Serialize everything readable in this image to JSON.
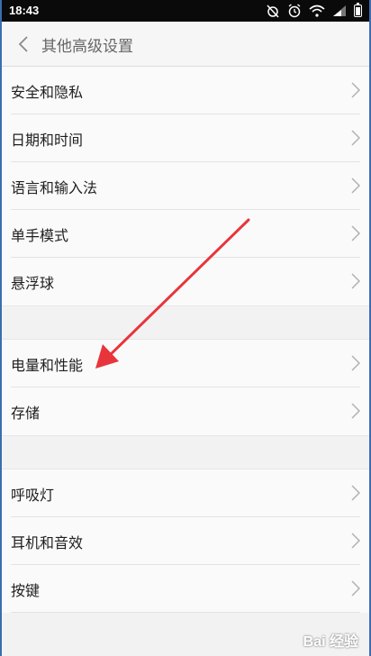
{
  "status_bar": {
    "time": "18:43",
    "icons": [
      "alarm-off-icon",
      "alarm-icon",
      "wifi-icon",
      "signal-icon",
      "battery-icon"
    ]
  },
  "header": {
    "title": "其他高级设置",
    "back_icon": "chevron-left-icon"
  },
  "settings": {
    "group1": [
      {
        "label": "安全和隐私"
      },
      {
        "label": "日期和时间"
      },
      {
        "label": "语言和输入法"
      },
      {
        "label": "单手模式"
      },
      {
        "label": "悬浮球"
      }
    ],
    "group2": [
      {
        "label": "电量和性能"
      },
      {
        "label": "存储"
      }
    ],
    "group3": [
      {
        "label": "呼吸灯"
      },
      {
        "label": "耳机和音效"
      },
      {
        "label": "按键"
      }
    ]
  },
  "annotation": {
    "arrow_color": "#e8353b",
    "points_to": "电量和性能"
  },
  "watermark": {
    "text": "Bai 经验"
  },
  "colors": {
    "status_bar_bg": "#0a0a0a",
    "header_bg": "#f6f6f6",
    "row_bg": "#fafafa",
    "chevron": "#b0b0b0"
  }
}
